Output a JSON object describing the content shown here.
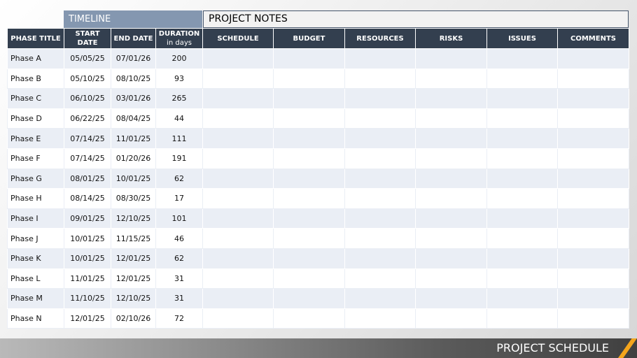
{
  "sections": {
    "timeline": "TIMELINE",
    "notes": "PROJECT NOTES"
  },
  "table": {
    "headers": {
      "phase_title": "PHASE TITLE",
      "start_date": "START DATE",
      "end_date": "END DATE",
      "duration": "DURATION",
      "duration_unit": "in days",
      "schedule": "SCHEDULE",
      "budget": "BUDGET",
      "resources": "RESOURCES",
      "risks": "RISKS",
      "issues": "ISSUES",
      "comments": "COMMENTS"
    },
    "rows": [
      {
        "title": "Phase A",
        "start": "05/05/25",
        "end": "07/01/26",
        "duration": "200"
      },
      {
        "title": "Phase B",
        "start": "05/10/25",
        "end": "08/10/25",
        "duration": "93"
      },
      {
        "title": "Phase C",
        "start": "06/10/25",
        "end": "03/01/26",
        "duration": "265"
      },
      {
        "title": "Phase D",
        "start": "06/22/25",
        "end": "08/04/25",
        "duration": "44"
      },
      {
        "title": "Phase E",
        "start": "07/14/25",
        "end": "11/01/25",
        "duration": "111"
      },
      {
        "title": "Phase F",
        "start": "07/14/25",
        "end": "01/20/26",
        "duration": "191"
      },
      {
        "title": "Phase G",
        "start": "08/01/25",
        "end": "10/01/25",
        "duration": "62"
      },
      {
        "title": "Phase H",
        "start": "08/14/25",
        "end": "08/30/25",
        "duration": "17"
      },
      {
        "title": "Phase I",
        "start": "09/01/25",
        "end": "12/10/25",
        "duration": "101"
      },
      {
        "title": "Phase J",
        "start": "10/01/25",
        "end": "11/15/25",
        "duration": "46"
      },
      {
        "title": "Phase K",
        "start": "10/01/25",
        "end": "12/01/25",
        "duration": "62"
      },
      {
        "title": "Phase L",
        "start": "11/01/25",
        "end": "12/01/25",
        "duration": "31"
      },
      {
        "title": "Phase M",
        "start": "11/10/25",
        "end": "12/10/25",
        "duration": "31"
      },
      {
        "title": "Phase N",
        "start": "12/01/25",
        "end": "02/10/26",
        "duration": "72"
      }
    ]
  },
  "footer": {
    "title": "PROJECT SCHEDULE"
  },
  "colors": {
    "header_bg": "#333f4f",
    "timeline_bg": "#8497b0",
    "row_alt_bg": "#eaeef5",
    "accent_stripe": "#f4a51c"
  }
}
